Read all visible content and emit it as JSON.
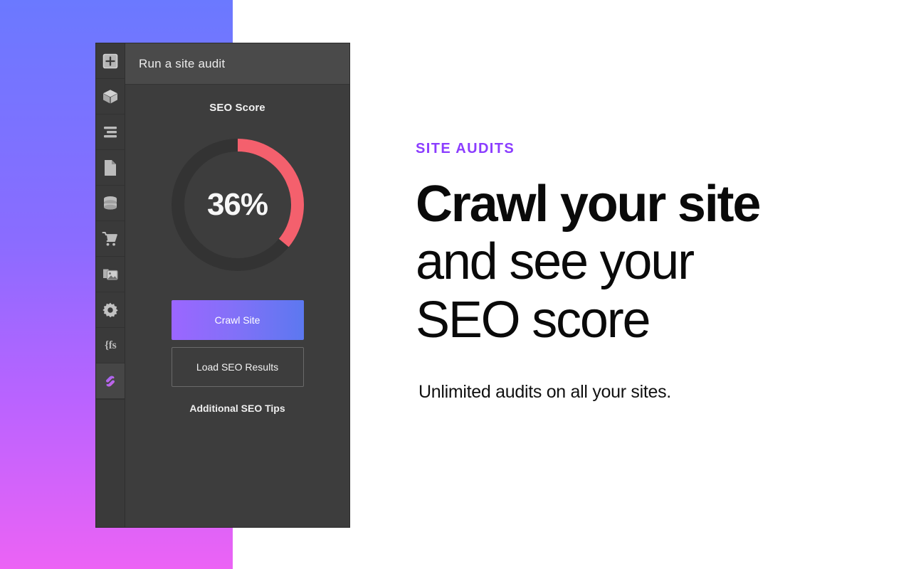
{
  "theme": {
    "gradient_top": "#6b79ff",
    "gradient_bottom": "#ec63f5",
    "accent_purple": "#8b3dff",
    "gauge_arc": "#f4606d",
    "gauge_track": "#333333",
    "panel_bg": "#3d3d3d",
    "header_bg": "#4a4a4a",
    "button_gradient_start": "#9b66ff",
    "button_gradient_end": "#5c78f0"
  },
  "sidebar": {
    "items": [
      {
        "icon": "plus-box-icon",
        "active": false
      },
      {
        "icon": "cube-icon",
        "active": false
      },
      {
        "icon": "list-lines-icon",
        "active": false
      },
      {
        "icon": "document-icon",
        "active": false
      },
      {
        "icon": "database-icon",
        "active": false
      },
      {
        "icon": "cart-icon",
        "active": false
      },
      {
        "icon": "image-icon",
        "active": false
      },
      {
        "icon": "gear-icon",
        "active": false
      },
      {
        "icon": "fs-code-icon",
        "active": false,
        "label": "{fs"
      },
      {
        "icon": "seo-logo-icon",
        "active": true
      }
    ]
  },
  "panel": {
    "title": "Run a site audit",
    "score_label": "SEO Score",
    "score_value": "36%",
    "score_percent": 36,
    "primary_button": "Crawl Site",
    "secondary_button": "Load SEO Results",
    "tips_link": "Additional SEO Tips"
  },
  "copy": {
    "eyebrow": "SITE AUDITS",
    "headline_line1": "Crawl your site",
    "headline_line2": "and see your",
    "headline_line3": "SEO score",
    "subcopy": "Unlimited audits on all your sites."
  }
}
